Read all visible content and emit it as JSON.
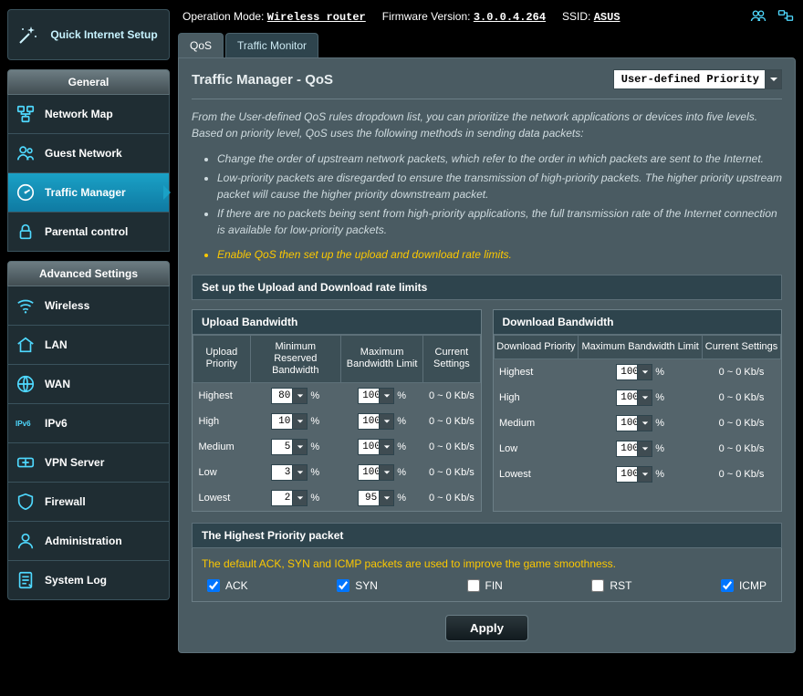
{
  "top": {
    "op_mode_label": "Operation Mode:",
    "op_mode_value": "Wireless router",
    "fw_label": "Firmware Version:",
    "fw_value": "3.0.0.4.264",
    "ssid_label": "SSID:",
    "ssid_value": "ASUS"
  },
  "sidebar": {
    "quick": "Quick Internet Setup",
    "general_head": "General",
    "general_items": [
      {
        "label": "Network Map"
      },
      {
        "label": "Guest Network"
      },
      {
        "label": "Traffic Manager"
      },
      {
        "label": "Parental control"
      }
    ],
    "advanced_head": "Advanced Settings",
    "advanced_items": [
      {
        "label": "Wireless"
      },
      {
        "label": "LAN"
      },
      {
        "label": "WAN"
      },
      {
        "label": "IPv6"
      },
      {
        "label": "VPN Server"
      },
      {
        "label": "Firewall"
      },
      {
        "label": "Administration"
      },
      {
        "label": "System Log"
      }
    ]
  },
  "tabs": [
    "QoS",
    "Traffic Monitor"
  ],
  "panel": {
    "title": "Traffic Manager - QoS",
    "mode_value": "User-defined Priority",
    "intro": "From the User-defined QoS rules dropdown list, you can prioritize the network applications or devices into five levels. Based on priority level, QoS uses the following methods in sending data packets:",
    "bullets": [
      "Change the order of upstream network packets, which refer to the order in which packets are sent to the Internet.",
      "Low-priority packets are disregarded to ensure the transmission of high-priority packets. The higher priority upstream packet will cause the higher priority downstream packet.",
      "If there are no packets being sent from high-priority applications, the full transmission rate of the Internet connection is available for low-priority packets."
    ],
    "enable_note": "Enable QoS then set up the upload and download rate limits.",
    "rate_section_title": "Set up the Upload and Download rate limits"
  },
  "upload": {
    "title": "Upload Bandwidth",
    "cols": [
      "Upload Priority",
      "Minimum Reserved Bandwidth",
      "Maximum Bandwidth Limit",
      "Current Settings"
    ],
    "rows": [
      {
        "p": "Highest",
        "min": "80",
        "max": "100",
        "cur": "0 ~ 0 Kb/s"
      },
      {
        "p": "High",
        "min": "10",
        "max": "100",
        "cur": "0 ~ 0 Kb/s"
      },
      {
        "p": "Medium",
        "min": "5",
        "max": "100",
        "cur": "0 ~ 0 Kb/s"
      },
      {
        "p": "Low",
        "min": "3",
        "max": "100",
        "cur": "0 ~ 0 Kb/s"
      },
      {
        "p": "Lowest",
        "min": "2",
        "max": "95",
        "cur": "0 ~ 0 Kb/s"
      }
    ]
  },
  "download": {
    "title": "Download Bandwidth",
    "cols": [
      "Download Priority",
      "Maximum Bandwidth Limit",
      "Current Settings"
    ],
    "rows": [
      {
        "p": "Highest",
        "max": "100",
        "cur": "0 ~ 0 Kb/s"
      },
      {
        "p": "High",
        "max": "100",
        "cur": "0 ~ 0 Kb/s"
      },
      {
        "p": "Medium",
        "max": "100",
        "cur": "0 ~ 0 Kb/s"
      },
      {
        "p": "Low",
        "max": "100",
        "cur": "0 ~ 0 Kb/s"
      },
      {
        "p": "Lowest",
        "max": "100",
        "cur": "0 ~ 0 Kb/s"
      }
    ]
  },
  "pkt": {
    "title": "The Highest Priority packet",
    "note": "The default ACK, SYN and ICMP packets are used to improve the game smoothness.",
    "items": [
      {
        "label": "ACK",
        "checked": true
      },
      {
        "label": "SYN",
        "checked": true
      },
      {
        "label": "FIN",
        "checked": false
      },
      {
        "label": "RST",
        "checked": false
      },
      {
        "label": "ICMP",
        "checked": true
      }
    ]
  },
  "apply_label": "Apply",
  "pct": "%"
}
